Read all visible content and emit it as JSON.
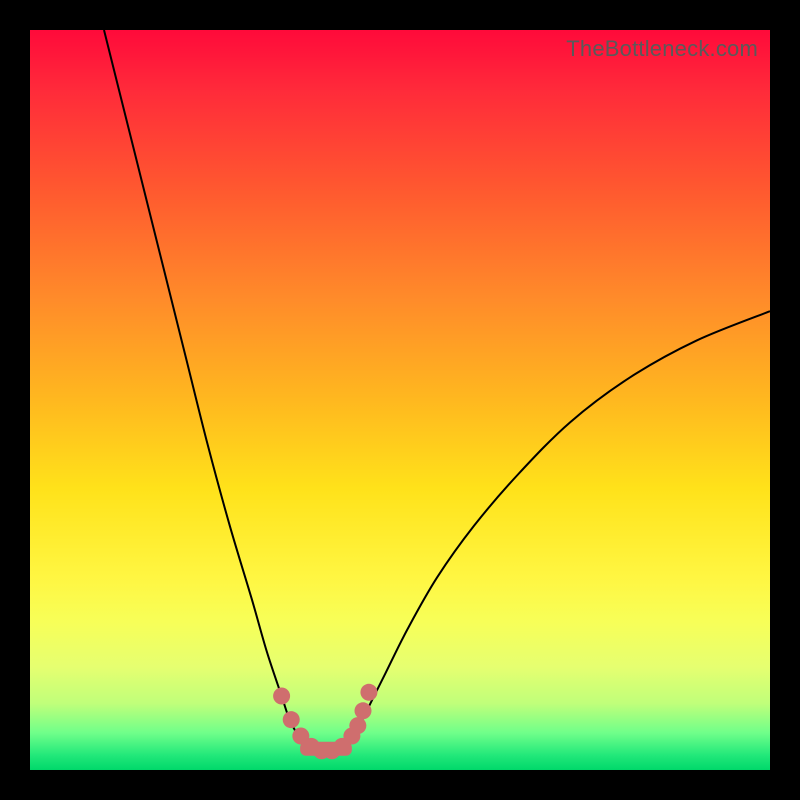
{
  "watermark": "TheBottleneck.com",
  "colors": {
    "frame_bg": "#000000",
    "gradient_top": "#ff0a3a",
    "gradient_bottom": "#00d86a",
    "curve": "#000000",
    "marker": "#cf6e6e"
  },
  "chart_data": {
    "type": "line",
    "title": "",
    "xlabel": "",
    "ylabel": "",
    "xlim": [
      0,
      100
    ],
    "ylim": [
      0,
      100
    ],
    "grid": false,
    "legend": false,
    "series": [
      {
        "name": "left-curve",
        "x": [
          10,
          12,
          15,
          18,
          21,
          24,
          27,
          30,
          32,
          34,
          35,
          36,
          37
        ],
        "y": [
          100,
          92,
          80,
          68,
          56,
          44,
          33,
          23,
          16,
          10,
          7,
          5,
          3
        ]
      },
      {
        "name": "right-curve",
        "x": [
          43,
          44,
          46,
          48,
          51,
          55,
          60,
          66,
          73,
          81,
          90,
          100
        ],
        "y": [
          3,
          5,
          9,
          13,
          19,
          26,
          33,
          40,
          47,
          53,
          58,
          62
        ]
      }
    ],
    "markers": {
      "name": "bottom-cluster",
      "x": [
        34.0,
        35.3,
        36.6,
        38.0,
        39.4,
        40.8,
        42.2,
        43.5,
        44.3,
        45.0,
        45.8
      ],
      "y": [
        10.0,
        6.8,
        4.6,
        3.2,
        2.6,
        2.6,
        3.2,
        4.6,
        6.0,
        8.0,
        10.5
      ]
    },
    "annotations": []
  }
}
